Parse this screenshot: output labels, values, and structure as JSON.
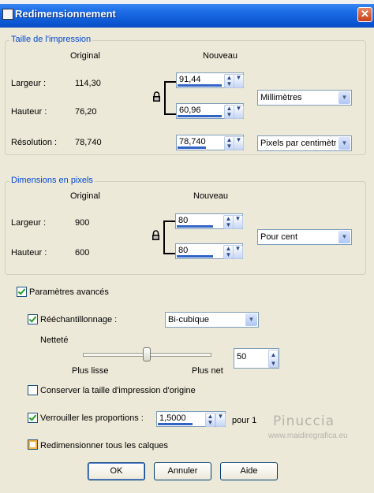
{
  "window": {
    "title": "Redimensionnement",
    "close_glyph": "✕"
  },
  "print_size": {
    "group_label": "Taille de l'impression",
    "col_original": "Original",
    "col_new": "Nouveau",
    "width_label": "Largeur :",
    "width_original": "114,30",
    "width_new": "91,44",
    "height_label": "Hauteur :",
    "height_original": "76,20",
    "height_new": "60,96",
    "resolution_label": "Résolution :",
    "resolution_original": "78,740",
    "resolution_new": "78,740",
    "unit_select": "Millimètres",
    "resolution_unit_select": "Pixels par centimètre"
  },
  "pixel_dims": {
    "group_label": "Dimensions en pixels",
    "col_original": "Original",
    "col_new": "Nouveau",
    "width_label": "Largeur :",
    "width_original": "900",
    "width_new": "80",
    "height_label": "Hauteur :",
    "height_original": "600",
    "height_new": "80",
    "unit_select": "Pour cent"
  },
  "advanced": {
    "label": "Paramètres avancés",
    "checked": true,
    "resample_label": "Rééchantillonnage :",
    "resample_checked": true,
    "resample_method": "Bi-cubique",
    "sharpness_label": "Netteté",
    "slider_min_label": "Plus lisse",
    "slider_max_label": "Plus net",
    "sharpness_value": "50",
    "keep_print_size_label": "Conserver la taille d'impression d'origine",
    "keep_print_size_checked": false,
    "lock_ratio_label": "Verrouiller les proportions :",
    "lock_ratio_checked": true,
    "ratio_value": "1,5000",
    "ratio_suffix": "pour 1",
    "resize_layers_label": "Redimensionner tous les calques",
    "resize_layers_checked": false
  },
  "watermark": {
    "line1": "Pinuccia",
    "line2": "www.maidiregrafica.eu"
  },
  "buttons": {
    "ok": "OK",
    "cancel": "Annuler",
    "help": "Aide"
  },
  "icons": {
    "lock": "lock-icon",
    "spin_up": "▲",
    "spin_down": "▼",
    "dropdown": "▼"
  }
}
